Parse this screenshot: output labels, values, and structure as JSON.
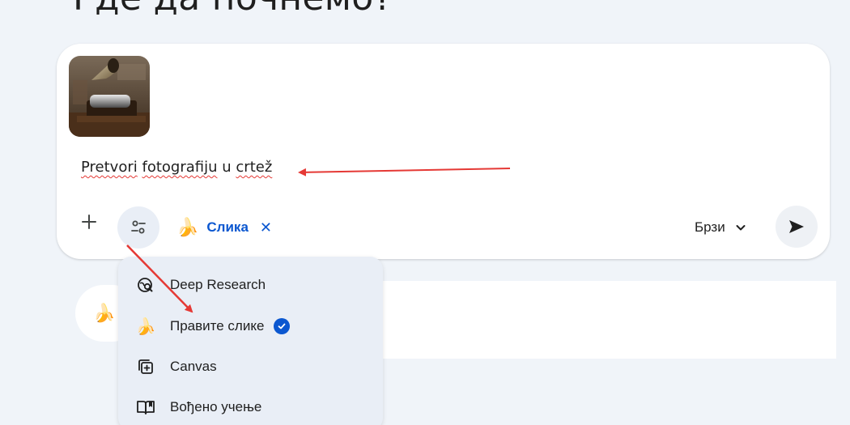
{
  "page": {
    "heading": "Где да почнемо?"
  },
  "composer": {
    "attachment_icon": "gramophone-photo",
    "prompt_parts": [
      "Pretvori",
      "fotografiju",
      "u",
      "crtež"
    ],
    "plus_icon": "plus-icon",
    "tools_icon": "tools-sliders-icon",
    "active_tool": {
      "emoji": "🍌",
      "label": "Слика",
      "remove": "✕"
    },
    "model_label": "Брзи",
    "send_icon": "send-icon"
  },
  "tools_menu": {
    "items": [
      {
        "label": "Deep Research",
        "icon": "deep-research-icon"
      },
      {
        "label": "Правите слике",
        "icon": "banana-icon",
        "emoji": "🍌",
        "selected": true
      },
      {
        "label": "Canvas",
        "icon": "canvas-icon"
      },
      {
        "label": "Вођено учење",
        "icon": "book-icon"
      }
    ]
  },
  "background_pill": {
    "emoji": "🍌"
  },
  "colors": {
    "accent": "#0b57d0",
    "background": "#f0f4f9",
    "menu_bg": "#e9eef6",
    "annotation_arrow": "#e53935"
  }
}
